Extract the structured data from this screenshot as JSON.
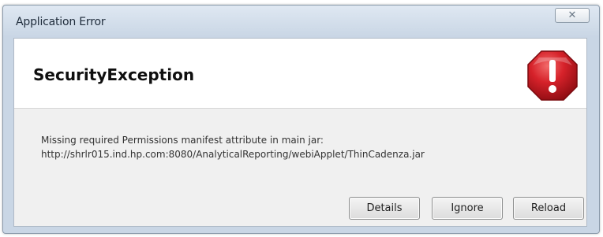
{
  "window": {
    "title": "Application Error",
    "close_glyph": "✕"
  },
  "header": {
    "exception_name": "SecurityException",
    "icon": "stop-error-icon",
    "icon_color": "#c8161d"
  },
  "message": {
    "line1": "Missing required Permissions manifest attribute in main jar:",
    "line2": "http://shrlr015.ind.hp.com:8080/AnalyticalReporting/webiApplet/ThinCadenza.jar"
  },
  "buttons": {
    "details": "Details",
    "ignore": "Ignore",
    "reload": "Reload"
  }
}
